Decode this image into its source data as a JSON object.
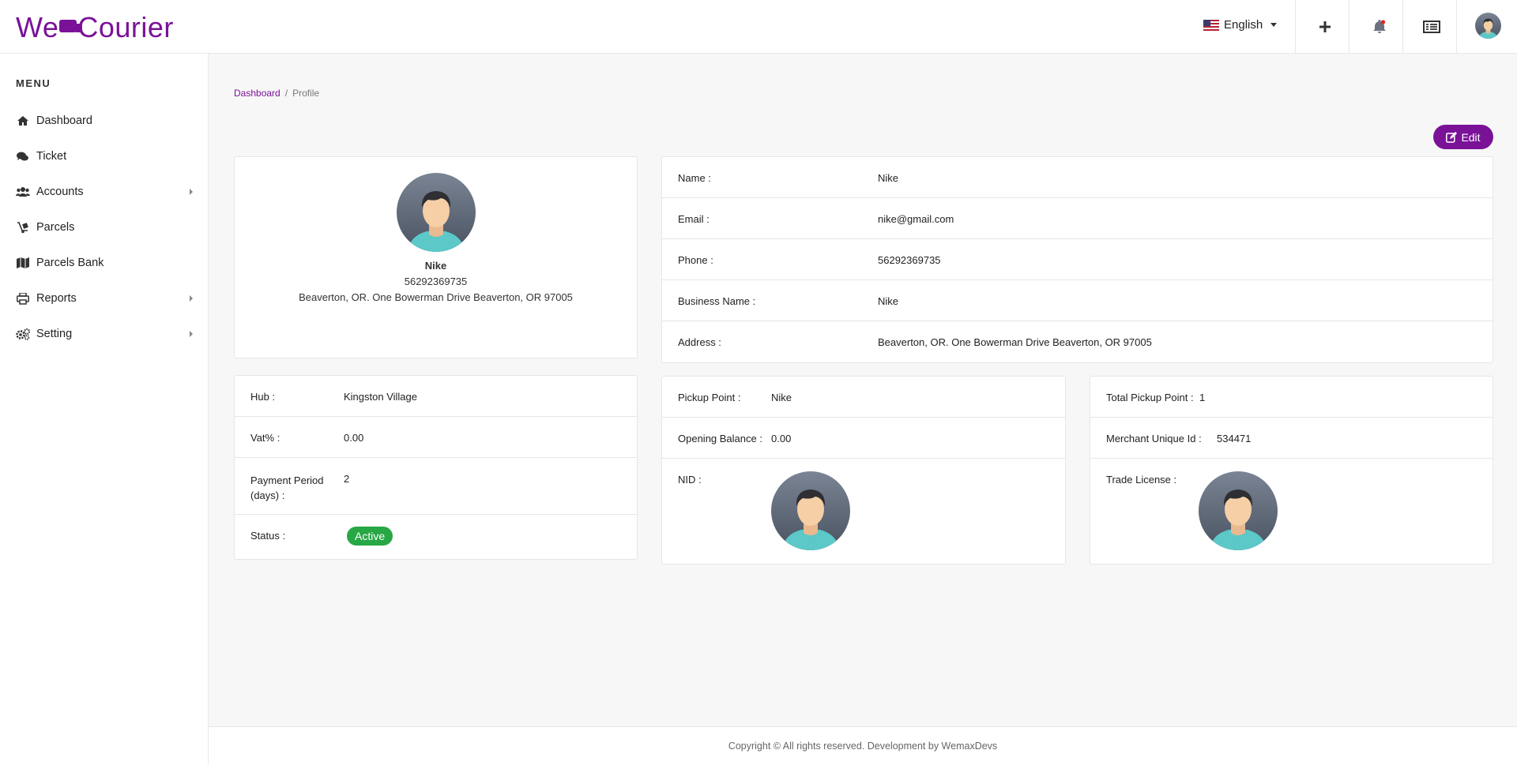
{
  "brand": {
    "logo_left": "We",
    "logo_right": "Courier",
    "accent": "#7a1298"
  },
  "header": {
    "language": "English",
    "icons": [
      "plus-icon",
      "bell-icon",
      "list-icon",
      "user-avatar"
    ]
  },
  "sidebar": {
    "menu_title": "MENU",
    "items": [
      {
        "label": "Dashboard",
        "icon": "home-icon"
      },
      {
        "label": "Ticket",
        "icon": "comments-icon"
      },
      {
        "label": "Accounts",
        "icon": "users-icon",
        "has_submenu": true
      },
      {
        "label": "Parcels",
        "icon": "dolly-icon"
      },
      {
        "label": "Parcels Bank",
        "icon": "map-icon"
      },
      {
        "label": "Reports",
        "icon": "print-icon",
        "has_submenu": true
      },
      {
        "label": "Setting",
        "icon": "cogs-icon",
        "has_submenu": true
      }
    ]
  },
  "breadcrumb": {
    "home": "Dashboard",
    "separator": "/",
    "current": "Profile"
  },
  "actions": {
    "edit_label": "Edit"
  },
  "profile": {
    "name": "Nike",
    "phone": "56292369735",
    "address": "Beaverton, OR. One Bowerman Drive Beaverton, OR 97005"
  },
  "details": {
    "name_label": "Name :",
    "name_value": "Nike",
    "email_label": "Email :",
    "email_value": "nike@gmail.com",
    "phone_label": "Phone :",
    "phone_value": "56292369735",
    "business_label": "Business Name :",
    "business_value": "Nike",
    "address_label": "Address :",
    "address_value": "Beaverton, OR. One Bowerman Drive Beaverton, OR 97005"
  },
  "hub_card": {
    "hub_label": "Hub :",
    "hub_value": "Kingston Village",
    "vat_label": "Vat% :",
    "vat_value": "0.00",
    "payment_label_1": "Payment Period",
    "payment_label_2": "(days) :",
    "payment_value": "2",
    "status_label": "Status :",
    "status_value": "Active",
    "status_color": "#28a745"
  },
  "pickup_card": {
    "pickup_label": "Pickup Point :",
    "pickup_value": "Nike",
    "balance_label": "Opening Balance :",
    "balance_value": "0.00",
    "nid_label": "NID :"
  },
  "merchant_card": {
    "total_label": "Total Pickup Point :",
    "total_value": "1",
    "unique_label": "Merchant Unique Id :",
    "unique_value": "534471",
    "trade_label": "Trade License :"
  },
  "footer": {
    "text": "Copyright © All rights reserved. Development by WemaxDevs"
  }
}
